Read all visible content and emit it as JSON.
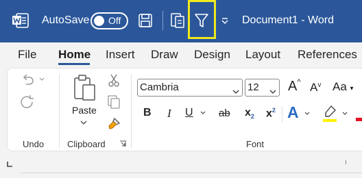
{
  "titlebar": {
    "app_icon": "word-logo-icon",
    "autosave_label": "AutoSave",
    "autosave_state": "Off",
    "doc_title": "Document1  -  Word",
    "background": "#2b579a",
    "highlight_color": "#f0e81c"
  },
  "tabs": [
    {
      "label": "File"
    },
    {
      "label": "Home",
      "active": true
    },
    {
      "label": "Insert"
    },
    {
      "label": "Draw"
    },
    {
      "label": "Design"
    },
    {
      "label": "Layout"
    },
    {
      "label": "References"
    }
  ],
  "ribbon": {
    "undo_group_label": "Undo",
    "clipboard_group_label": "Clipboard",
    "paste_label": "Paste",
    "font_group_label": "Font",
    "font_name": "Cambria",
    "font_size": "12",
    "bold": "B",
    "italic": "I",
    "underline": "U",
    "strikethrough": "ab",
    "subscript": "x",
    "subscript_mark": "2",
    "superscript": "x",
    "superscript_mark": "2",
    "change_case": "Aa",
    "text_effects": "A",
    "grow_font": "A",
    "shrink_font": "A",
    "highlight_color_value": "#fff200",
    "font_color_value": "#e81123"
  }
}
